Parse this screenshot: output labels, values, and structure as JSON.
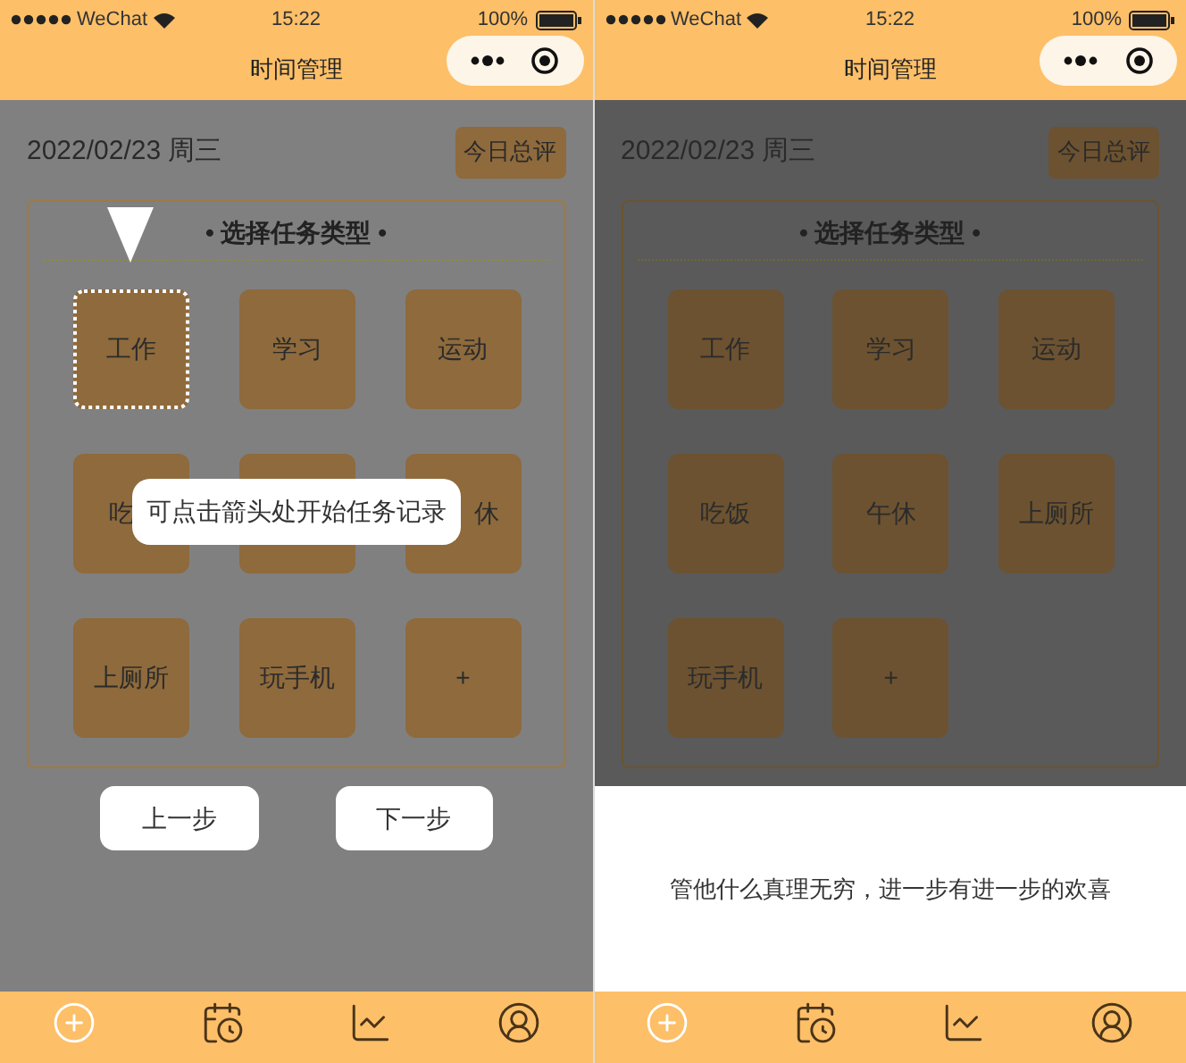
{
  "screens": [
    {
      "kind": "guide",
      "status_bar": {
        "carrier": "WeChat",
        "time": "15:22",
        "battery": "100%"
      },
      "nav_title": "时间管理",
      "date": "2022/02/23 周三",
      "review_button": "今日总评",
      "section_title": "• 选择任务类型 •",
      "tiles": [
        {
          "label": "工作",
          "selected": true
        },
        {
          "label": "学习",
          "selected": false
        },
        {
          "label": "运动",
          "selected": false
        },
        {
          "label": "吃",
          "selected": false,
          "kind": "clipped"
        },
        {
          "selected": false,
          "kind": "hidden"
        },
        {
          "label": "休",
          "selected": false,
          "kind": "clipped"
        },
        {
          "label": "上厕所",
          "selected": false
        },
        {
          "label": "玩手机",
          "selected": false
        },
        {
          "label": "+",
          "selected": false
        }
      ],
      "guide": {
        "tooltip": "可点击箭头处开始任务记录",
        "prev_button": "上一步",
        "next_button": "下一步"
      },
      "tabs": [
        {
          "selected": true
        },
        {
          "selected": false
        },
        {
          "selected": false
        },
        {
          "selected": false
        }
      ]
    },
    {
      "kind": "sheet",
      "status_bar": {
        "carrier": "WeChat",
        "time": "15:22",
        "battery": "100%"
      },
      "nav_title": "时间管理",
      "date": "2022/02/23 周三",
      "review_button": "今日总评",
      "section_title": "• 选择任务类型 •",
      "tiles": [
        {
          "label": "工作",
          "selected": false
        },
        {
          "label": "学习",
          "selected": false
        },
        {
          "label": "运动",
          "selected": false
        },
        {
          "label": "吃饭",
          "selected": false
        },
        {
          "label": "午休",
          "selected": false
        },
        {
          "label": "上厕所",
          "selected": false
        },
        {
          "label": "玩手机",
          "selected": false
        },
        {
          "label": "+",
          "selected": false
        }
      ],
      "sheet_text": "管他什么真理无穷，进一步有进一步的欢喜",
      "tabs": [
        {
          "selected": true
        },
        {
          "selected": false
        },
        {
          "selected": false
        },
        {
          "selected": false
        }
      ]
    }
  ]
}
